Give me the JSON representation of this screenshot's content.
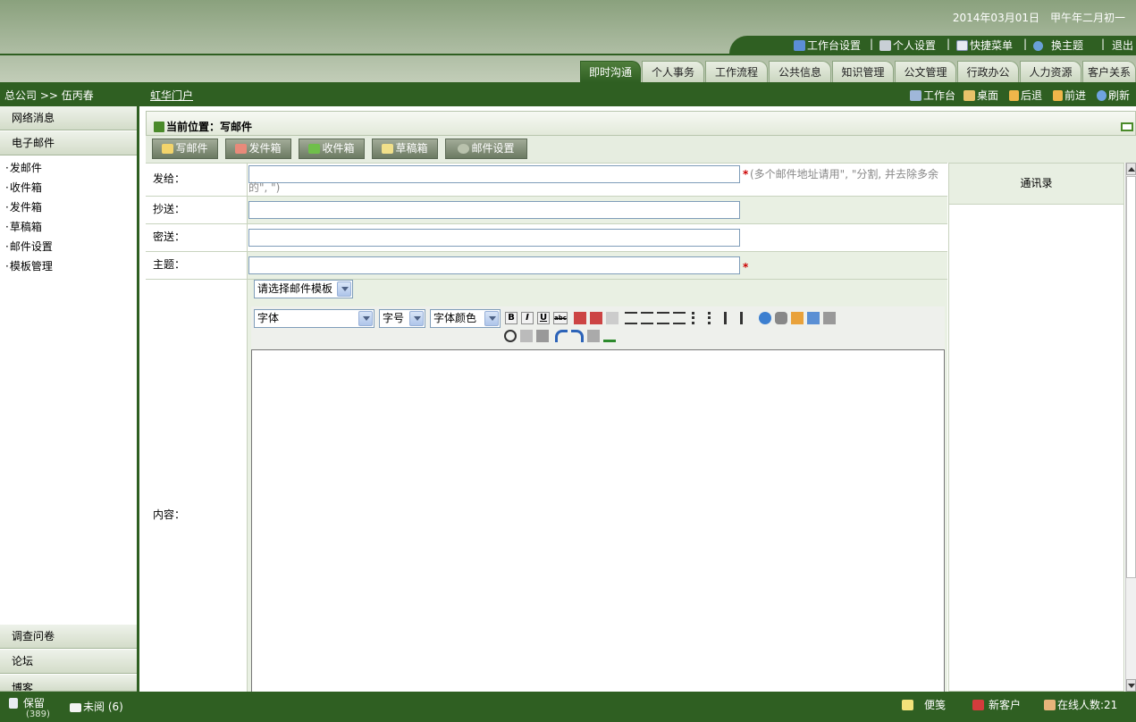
{
  "header": {
    "date": "2014年03月01日",
    "lunar": "甲午年二月初一",
    "toolbar": [
      {
        "label": "工作台设置",
        "icon": "monitor-icon"
      },
      {
        "label": "个人设置",
        "icon": "wrench-icon"
      },
      {
        "label": "快捷菜单",
        "icon": "edit-icon"
      },
      {
        "label": "换主题",
        "icon": "globe-icon"
      },
      {
        "label": "退出",
        "icon": ""
      }
    ],
    "tabs": [
      "即时沟通",
      "个人事务",
      "工作流程",
      "公共信息",
      "知识管理",
      "公文管理",
      "行政办公",
      "人力资源",
      "客户关系"
    ],
    "active_tab": "即时沟通"
  },
  "navbar": {
    "breadcrumb": "总公司 >> 伍丙春",
    "portal": "虹华门户",
    "buttons": [
      "工作台",
      "桌面",
      "后退",
      "前进",
      "刷新"
    ]
  },
  "sidebar": {
    "top_categories": [
      "网络消息",
      "电子邮件"
    ],
    "items": [
      "发邮件",
      "收件箱",
      "发件箱",
      "草稿箱",
      "邮件设置",
      "模板管理"
    ],
    "bottom_categories": [
      "调查问卷",
      "论坛",
      "博客"
    ]
  },
  "main": {
    "location": "当前位置：写邮件",
    "buttons": [
      "写邮件",
      "发件箱",
      "收件箱",
      "草稿箱",
      "邮件设置"
    ],
    "fields": {
      "to_label": "发给：",
      "to_hint": "(多个邮件地址请用\", \"分割, 并去除多余的\", \")",
      "cc_label": "抄送：",
      "bcc_label": "密送：",
      "subject_label": "主题：",
      "content_label": "内容：",
      "required_mark": "*"
    },
    "template_select": "请选择邮件模板",
    "editor": {
      "font": "字体",
      "size": "字号",
      "color": "字体颜色",
      "format_buttons": [
        "B",
        "I",
        "U",
        "abc"
      ]
    },
    "address_book": "通讯录"
  },
  "footer": {
    "save": "保留",
    "save_count": "(389)",
    "unread": "未阅 (6)",
    "memo": "便笺",
    "new_customer": "新客户",
    "online": "在线人数:21"
  }
}
